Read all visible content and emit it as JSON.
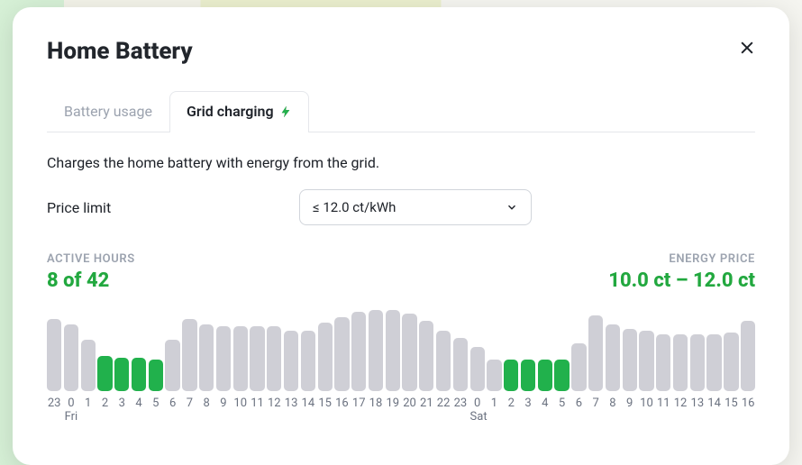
{
  "modal": {
    "title": "Home Battery"
  },
  "tabs": {
    "items": [
      {
        "label": "Battery usage",
        "active": false
      },
      {
        "label": "Grid charging",
        "active": true,
        "icon": "bolt"
      }
    ]
  },
  "description": "Charges the home battery with energy from the grid.",
  "price_limit": {
    "label": "Price limit",
    "value": "≤ 12.0 ct/kWh"
  },
  "stats": {
    "active_hours_label": "ACTIVE HOURS",
    "active_hours_value": "8 of 42",
    "energy_price_label": "ENERGY PRICE",
    "energy_price_value": "10.0 ct – 12.0 ct"
  },
  "chart_data": {
    "type": "bar",
    "title": "",
    "xlabel": "",
    "ylabel": "",
    "ylim": [
      0,
      90
    ],
    "categories": [
      "23",
      "0",
      "1",
      "2",
      "3",
      "4",
      "5",
      "6",
      "7",
      "8",
      "9",
      "10",
      "11",
      "12",
      "13",
      "14",
      "15",
      "16",
      "17",
      "18",
      "19",
      "20",
      "21",
      "22",
      "23",
      "0",
      "1",
      "2",
      "3",
      "4",
      "5",
      "6",
      "7",
      "8",
      "9",
      "10",
      "11",
      "12",
      "13",
      "14",
      "15",
      "16"
    ],
    "day_labels": [
      "",
      "Fri",
      "",
      "",
      "",
      "",
      "",
      "",
      "",
      "",
      "",
      "",
      "",
      "",
      "",
      "",
      "",
      "",
      "",
      "",
      "",
      "",
      "",
      "",
      "",
      "Sat",
      "",
      "",
      "",
      "",
      "",
      "",
      "",
      "",
      "",
      "",
      "",
      "",
      "",
      "",
      "",
      ""
    ],
    "series": [
      {
        "name": "price",
        "values": [
          78,
          72,
          56,
          38,
          36,
          36,
          34,
          56,
          78,
          72,
          70,
          70,
          70,
          70,
          66,
          66,
          74,
          80,
          86,
          88,
          88,
          84,
          76,
          66,
          58,
          48,
          34,
          34,
          34,
          34,
          34,
          52,
          82,
          72,
          68,
          66,
          62,
          62,
          62,
          62,
          64,
          76
        ]
      },
      {
        "name": "active",
        "values": [
          false,
          false,
          false,
          true,
          true,
          true,
          true,
          false,
          false,
          false,
          false,
          false,
          false,
          false,
          false,
          false,
          false,
          false,
          false,
          false,
          false,
          false,
          false,
          false,
          false,
          false,
          false,
          true,
          true,
          true,
          true,
          false,
          false,
          false,
          false,
          false,
          false,
          false,
          false,
          false,
          false,
          false
        ]
      }
    ]
  }
}
